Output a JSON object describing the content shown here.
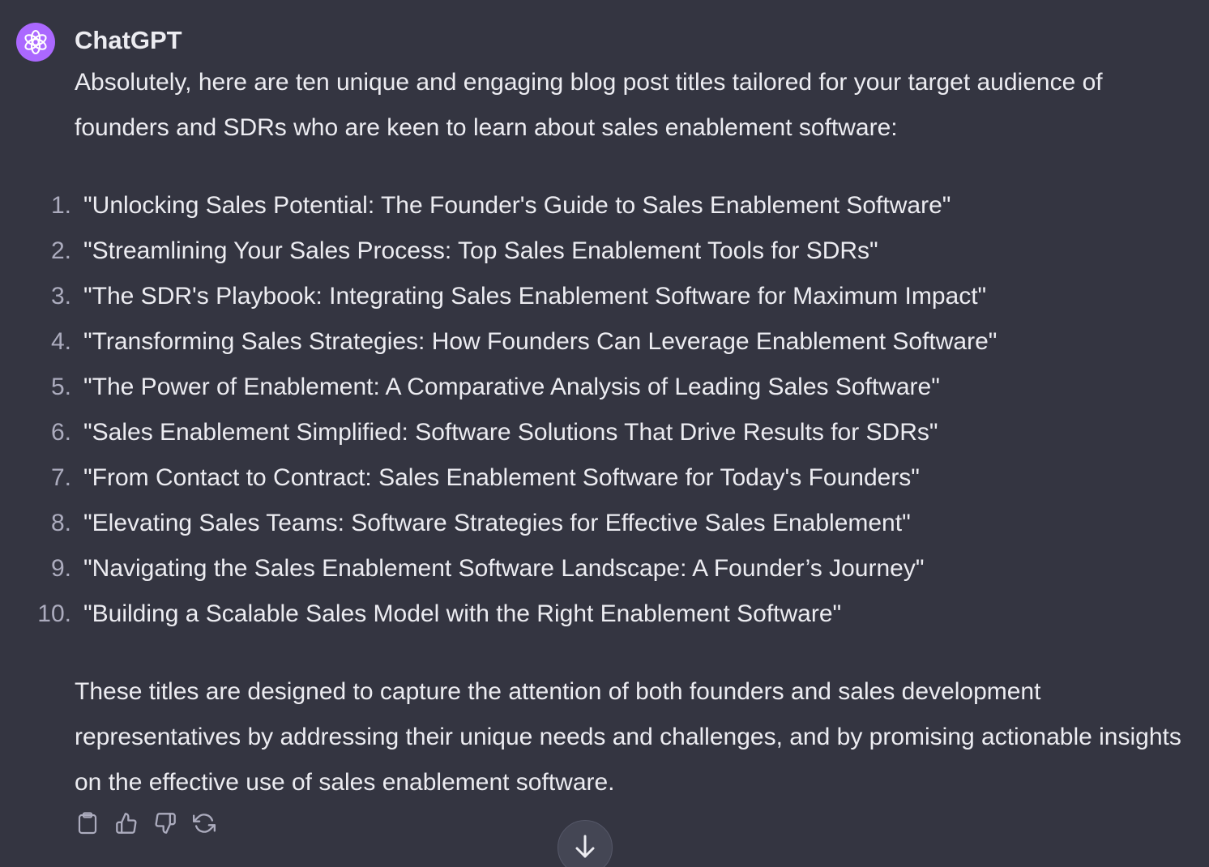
{
  "message": {
    "author": "ChatGPT",
    "intro": "Absolutely, here are ten unique and engaging blog post titles tailored for your target audience of founders and SDRs who are keen to learn about sales enablement software:",
    "titles": [
      {
        "num": "1.",
        "text": "\"Unlocking Sales Potential: The Founder's Guide to Sales Enablement Software\""
      },
      {
        "num": "2.",
        "text": "\"Streamlining Your Sales Process: Top Sales Enablement Tools for SDRs\""
      },
      {
        "num": "3.",
        "text": "\"The SDR's Playbook: Integrating Sales Enablement Software for Maximum Impact\""
      },
      {
        "num": "4.",
        "text": "\"Transforming Sales Strategies: How Founders Can Leverage Enablement Software\""
      },
      {
        "num": "5.",
        "text": "\"The Power of Enablement: A Comparative Analysis of Leading Sales Software\""
      },
      {
        "num": "6.",
        "text": "\"Sales Enablement Simplified: Software Solutions That Drive Results for SDRs\""
      },
      {
        "num": "7.",
        "text": "\"From Contact to Contract: Sales Enablement Software for Today's Founders\""
      },
      {
        "num": "8.",
        "text": "\"Elevating Sales Teams: Software Strategies for Effective Sales Enablement\""
      },
      {
        "num": "9.",
        "text": "\"Navigating the Sales Enablement Software Landscape: A Founder’s Journey\""
      },
      {
        "num": "10.",
        "text": "\"Building a Scalable Sales Model with the Right Enablement Software\""
      }
    ],
    "outro": "These titles are designed to capture the attention of both founders and sales development representatives by addressing their unique needs and challenges, and by promising actionable insights on the effective use of sales enablement software."
  },
  "icons": {
    "avatar": "openai-logo-icon",
    "copy": "clipboard-icon",
    "like": "thumbs-up-icon",
    "dislike": "thumbs-down-icon",
    "regenerate": "regenerate-icon",
    "scroll": "arrow-down-icon"
  },
  "colors": {
    "background": "#343541",
    "avatar": "#ab68ff",
    "text": "#ececf1",
    "muted": "#acacbe"
  }
}
